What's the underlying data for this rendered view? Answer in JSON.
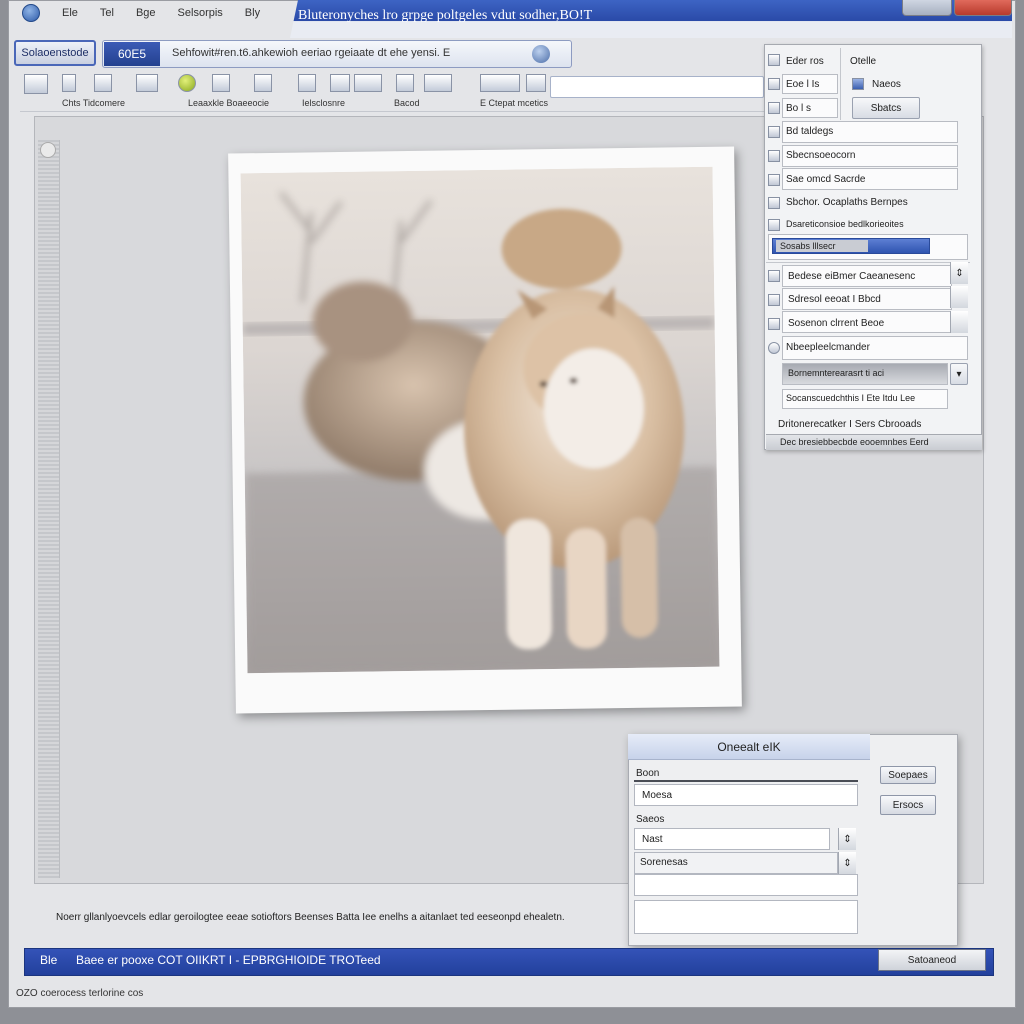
{
  "menu": [
    "Ele",
    "Tel",
    "Bge",
    "Selsorpis",
    "Bly"
  ],
  "window_title": "Bluteronyches lro grpge poltgeles vdut sodher,BO!T",
  "nav_button": "Solaoenstode",
  "address": {
    "tag": "60E5",
    "text": "Sehfowit#ren.t6.ahkewioh eeriao rgeiaate dt ehe yensi. E"
  },
  "toolbar": {
    "labels": [
      "Chts Tidcomere",
      "Leaaxkle Boaeeocie",
      "Ielsclosnre",
      "Bacod",
      "E Ctepat mcetics"
    ]
  },
  "panel": {
    "header_left": "Eder ros",
    "header_right": "Otelle",
    "r1_left": "Eoe l  Is",
    "r1_right": "Naeos",
    "r2_left": "Bo  l  s",
    "r2_button": "Sbatcs",
    "r3": "Bd taldegs",
    "r4": "Sbecnsoeocorn",
    "r5": "Sae omcd Sacrde",
    "r6": "Sbchor. Ocaplaths Bernpes",
    "r7": "Dsareticonsioe bedlkorieoites",
    "r8_label": "Sosabs lllsecr",
    "r9": "Bedese eiBmer Caeanesenc",
    "r10": "Sdresol eeoat I Bbcd",
    "r11": "Sosenon clrrent Beoe",
    "r12": "Nbeepleelcmander",
    "r13": "Bornemnterearasrt ti aci",
    "r14": "Socanscuedchthis I Ete Itdu Lee",
    "r15": "Dritonerecatker I Sers Cbrooads",
    "r16": "Dec bresiebbecbde eooemnbes Eerd"
  },
  "dialog": {
    "title": "Oneealt eIK",
    "label1": "Boon",
    "field1": "Moesa",
    "label2": "Saeos",
    "field2": "Nast",
    "field3": "Sorenesas",
    "button1": "Soepaes",
    "button2": "Ersocs"
  },
  "caption": "Noerr gllanlyoevcels edlar geroilogtee eeae sotioftors Beenses Batta Iee enelhs a aitanlaet ted eeseonpd ehealetn.",
  "status": {
    "id": "Ble",
    "text": "Baee er pooxe COT OIIKRT I - EPBRGHIOIDE TROTeed",
    "button": "Satoaneod"
  },
  "footer": "OZO coerocess terlorine cos"
}
